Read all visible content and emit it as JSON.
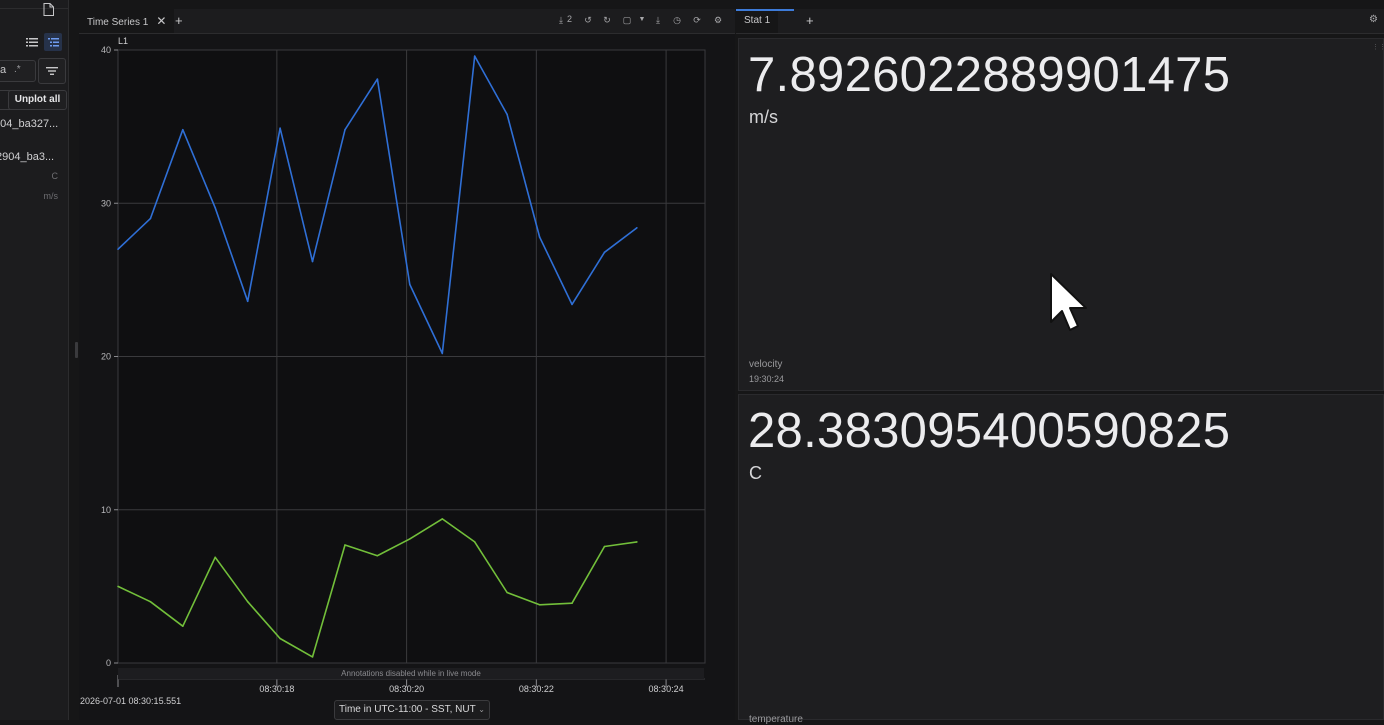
{
  "sidebar": {
    "filter_text": "a",
    "regex_label": ".*",
    "unplot_all_label": "Unplot all",
    "items": [
      {
        "label": "904_ba327...",
        "unit": ""
      },
      {
        "label": "2904_ba3...",
        "unit": "C"
      },
      {
        "label": "",
        "unit": "m/s"
      }
    ]
  },
  "left_tabs": [
    {
      "label": "Time Series 1",
      "close": "✕"
    }
  ],
  "right_tabs": [
    {
      "label": "Stat 1"
    }
  ],
  "toolbar": {
    "download_count": "2",
    "icons": [
      "download-icon",
      "undo-icon",
      "redo-icon",
      "layout-icon",
      "dropdown-icon",
      "export-icon",
      "clock-icon",
      "refresh-icon",
      "settings-icon"
    ]
  },
  "time_series": {
    "start_time": "2026-07-01 08:30:15.551",
    "timezone_label": "Time in UTC-11:00 - SST, NUT",
    "annotation_notice": "Annotations disabled while in live mode"
  },
  "chart_data": {
    "type": "line",
    "ylabel": "L1",
    "ylim": [
      0,
      40
    ],
    "yticks": [
      0,
      10,
      20,
      30,
      40
    ],
    "xlim": [
      "08:30:15.551",
      "08:30:24.6"
    ],
    "xtick_labels": [
      "08:30:18",
      "08:30:20",
      "08:30:22",
      "08:30:24"
    ],
    "grid": true,
    "x": [
      "08:30:15.551",
      "08:30:16.05",
      "08:30:16.55",
      "08:30:17.05",
      "08:30:17.55",
      "08:30:18.05",
      "08:30:18.55",
      "08:30:19.05",
      "08:30:19.55",
      "08:30:20.05",
      "08:30:20.55",
      "08:30:21.05",
      "08:30:21.55",
      "08:30:22.05",
      "08:30:22.55",
      "08:30:23.05",
      "08:30:23.55",
      "08:30:24.05"
    ],
    "series": [
      {
        "color": "#2f6fd6",
        "values": [
          27.0,
          29.0,
          34.8,
          29.7,
          23.6,
          34.9,
          26.2,
          34.8,
          38.1,
          24.7,
          20.2,
          39.6,
          35.8,
          27.8,
          23.4,
          26.8,
          28.4,
          null
        ]
      },
      {
        "color": "#72bf3a",
        "values": [
          5.0,
          4.0,
          2.4,
          6.9,
          4.0,
          1.6,
          0.4,
          7.7,
          7.0,
          8.1,
          9.4,
          7.9,
          4.6,
          3.8,
          3.9,
          7.6,
          7.9,
          null
        ]
      }
    ]
  },
  "stats": [
    {
      "value": "7.8926022889901475",
      "unit": "m/s",
      "name": "velocity",
      "time": "19:30:24"
    },
    {
      "value": "28.383095400590825",
      "unit": "C",
      "name": "temperature",
      "time": ""
    }
  ],
  "colors": {
    "accent": "#3d7bd9",
    "series_blue": "#2f6fd6",
    "series_green": "#72bf3a"
  }
}
